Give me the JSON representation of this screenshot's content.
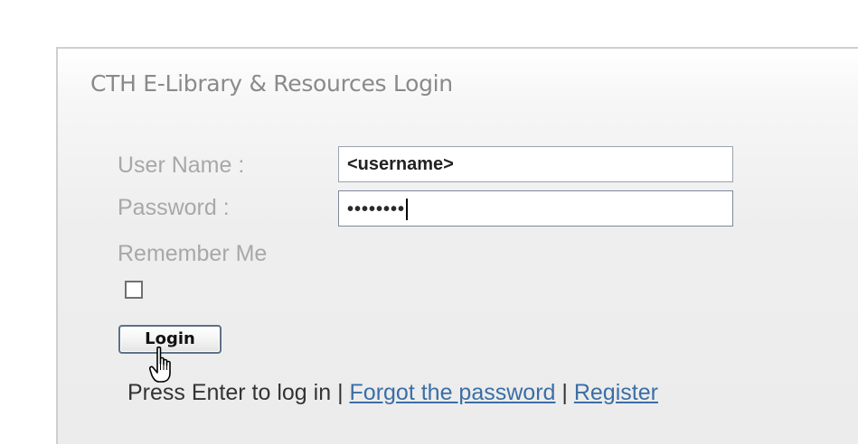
{
  "login": {
    "title": "CTH E-Library & Resources Login",
    "username_label": "User Name :",
    "username_value": "<username>",
    "password_label": "Password :",
    "password_masked": "••••••••",
    "remember_label": "Remember Me",
    "remember_checked": false,
    "login_button_label": "Login"
  },
  "footer": {
    "enter_text": "Press Enter to log in",
    "separator": "|",
    "forgot_link": "Forgot the password",
    "register_link": "Register"
  },
  "icons": {
    "cursor": "hand-pointer-icon"
  },
  "colors": {
    "link": "#3b6ea5",
    "label": "#a8a8a8",
    "title": "#8a8a8a",
    "button_border": "#5d7088"
  }
}
